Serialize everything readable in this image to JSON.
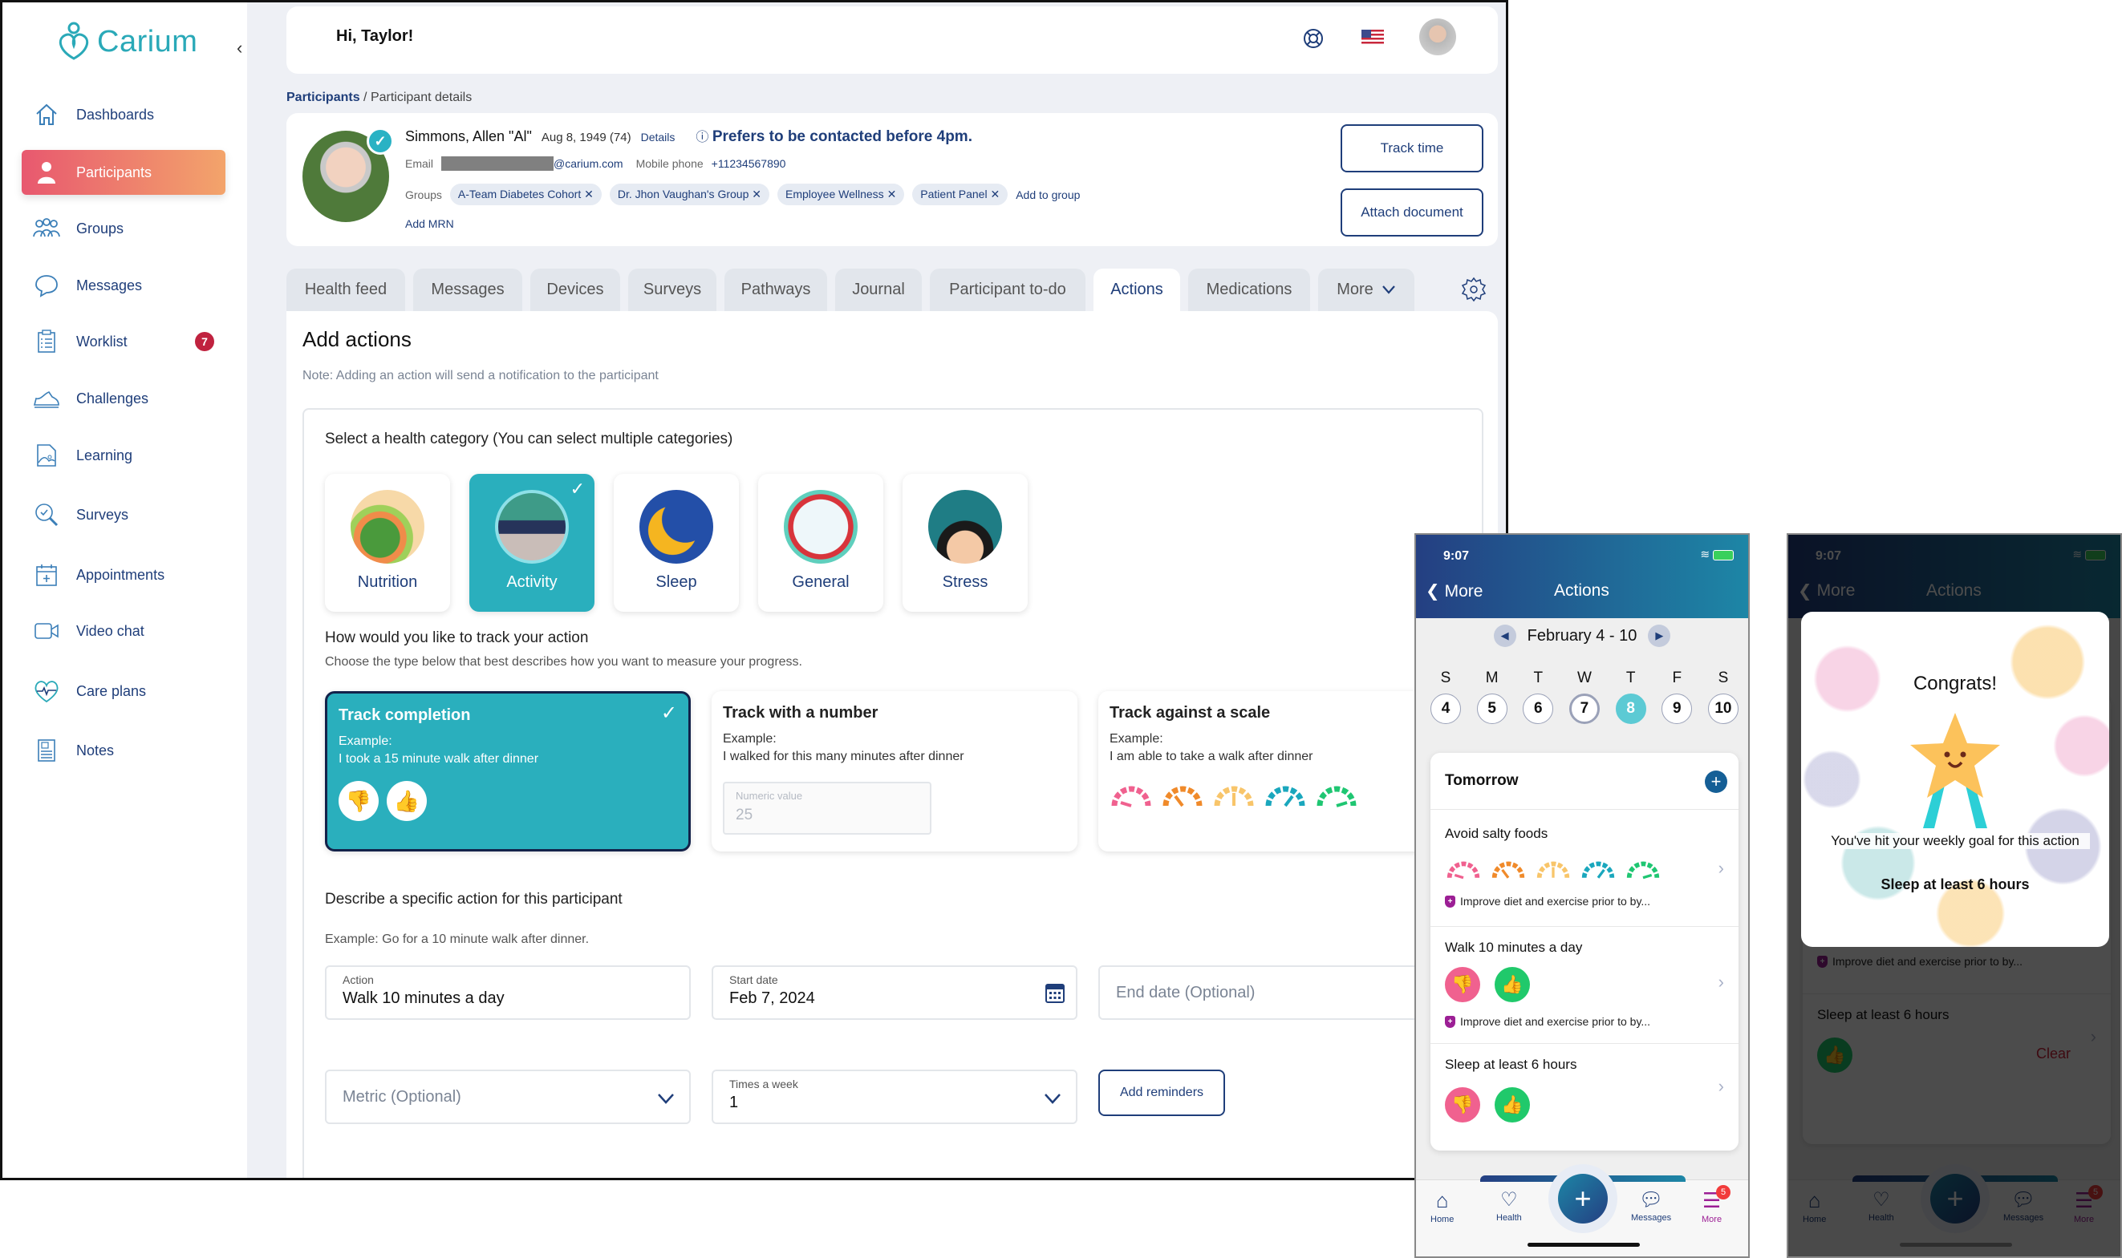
{
  "brand": {
    "name": "Carium",
    "color": "#2aa9b8"
  },
  "sidebar": {
    "items": [
      {
        "label": "Dashboards",
        "icon": "home-icon"
      },
      {
        "label": "Participants",
        "icon": "person-icon",
        "active": true
      },
      {
        "label": "Groups",
        "icon": "groups-icon"
      },
      {
        "label": "Messages",
        "icon": "chat-icon"
      },
      {
        "label": "Worklist",
        "icon": "clipboard-icon",
        "badge": "7"
      },
      {
        "label": "Challenges",
        "icon": "shoe-icon"
      },
      {
        "label": "Learning",
        "icon": "document-image-icon"
      },
      {
        "label": "Surveys",
        "icon": "magnifier-check-icon"
      },
      {
        "label": "Appointments",
        "icon": "calendar-plus-icon"
      },
      {
        "label": "Video chat",
        "icon": "video-icon"
      },
      {
        "label": "Care plans",
        "icon": "heart-pulse-icon"
      },
      {
        "label": "Notes",
        "icon": "note-icon"
      }
    ]
  },
  "header": {
    "greeting": "Hi, Taylor!"
  },
  "breadcrumb": {
    "parent": "Participants",
    "separator": " / ",
    "current": "Participant details"
  },
  "participant": {
    "name": "Simmons, Allen \"Al\"",
    "dob": "Aug 8, 1949 (74)",
    "details_link": "Details",
    "preference": "Prefers to be contacted before 4pm.",
    "email_label": "Email",
    "email_domain": "@carium.com",
    "phone_label": "Mobile phone",
    "phone": "+11234567890",
    "groups_label": "Groups",
    "groups": [
      "A-Team Diabetes Cohort",
      "Dr. Jhon Vaughan's Group",
      "Employee Wellness",
      "Patient Panel"
    ],
    "add_to_group": "Add to group",
    "add_mrn": "Add MRN",
    "track_time": "Track time",
    "attach_document": "Attach document"
  },
  "tabs": [
    {
      "label": "Health feed"
    },
    {
      "label": "Messages"
    },
    {
      "label": "Devices"
    },
    {
      "label": "Surveys"
    },
    {
      "label": "Pathways"
    },
    {
      "label": "Journal"
    },
    {
      "label": "Participant to-do"
    },
    {
      "label": "Actions",
      "active": true
    },
    {
      "label": "Medications"
    },
    {
      "label": "More"
    }
  ],
  "add_actions": {
    "title": "Add actions",
    "note": "Note: Adding an action will send a notification to the participant",
    "category_heading": "Select a health category (You can select multiple categories)",
    "categories": [
      {
        "label": "Nutrition",
        "selected": false
      },
      {
        "label": "Activity",
        "selected": true
      },
      {
        "label": "Sleep",
        "selected": false
      },
      {
        "label": "General",
        "selected": false
      },
      {
        "label": "Stress",
        "selected": false
      }
    ],
    "track_heading": "How would you like to track your action",
    "track_sub": "Choose the type below that best describes how you want to measure your progress.",
    "track_types": [
      {
        "title": "Track completion",
        "example_label": "Example:",
        "example": "I took a 15 minute walk after dinner",
        "selected": true
      },
      {
        "title": "Track with a number",
        "example_label": "Example:",
        "example": "I walked for this many minutes after dinner",
        "input_label": "Numeric value",
        "input_value": "25"
      },
      {
        "title": "Track against a scale",
        "example_label": "Example:",
        "example": "I am able to take a walk after dinner"
      }
    ],
    "describe_heading": "Describe a specific action for this participant",
    "describe_example": "Example: Go for a 10 minute walk after dinner.",
    "action_label": "Action",
    "action_value": "Walk 10 minutes a day",
    "start_label": "Start date",
    "start_value": "Feb 7, 2024",
    "end_placeholder": "End date (Optional)",
    "metric_placeholder": "Metric (Optional)",
    "times_label": "Times a week",
    "times_value": "1",
    "add_reminders": "Add reminders"
  },
  "phone1": {
    "time": "9:07",
    "back": "More",
    "title": "Actions",
    "week": "February 4 - 10",
    "days": [
      {
        "dow": "S",
        "num": "4"
      },
      {
        "dow": "M",
        "num": "5"
      },
      {
        "dow": "T",
        "num": "6"
      },
      {
        "dow": "W",
        "num": "7",
        "today": true
      },
      {
        "dow": "T",
        "num": "8",
        "selected": true
      },
      {
        "dow": "F",
        "num": "9"
      },
      {
        "dow": "S",
        "num": "10"
      }
    ],
    "section": "Tomorrow",
    "actions": [
      {
        "title": "Avoid salty foods",
        "goal": "Improve diet and exercise prior to by..."
      },
      {
        "title": "Walk 10 minutes a day",
        "goal": "Improve diet and exercise prior to by..."
      },
      {
        "title": "Sleep at least 6 hours"
      }
    ],
    "tabbar": [
      {
        "label": "Home"
      },
      {
        "label": "Health"
      },
      {
        "label": "Messages"
      },
      {
        "label": "More",
        "badge": "5"
      }
    ]
  },
  "phone2": {
    "time": "9:07",
    "back": "More",
    "title": "Actions",
    "modal_title": "Congrats!",
    "modal_text": "You've hit your weekly goal for this action",
    "modal_action": "Sleep at least 6 hours",
    "clear": "Clear",
    "goal": "Improve diet and exercise prior to by...",
    "sleep_title": "Sleep at least 6 hours",
    "tabbar": [
      {
        "label": "Home"
      },
      {
        "label": "Health"
      },
      {
        "label": "Messages"
      },
      {
        "label": "More",
        "badge": "5"
      }
    ]
  },
  "colors": {
    "navy": "#1f3e7a",
    "teal": "#2aafbd",
    "active_gradient_start": "#e8586f",
    "active_gradient_end": "#f3a46b",
    "badge": "#c0223f",
    "thumb_down": "#f0618f",
    "thumb_up": "#20c96b"
  }
}
